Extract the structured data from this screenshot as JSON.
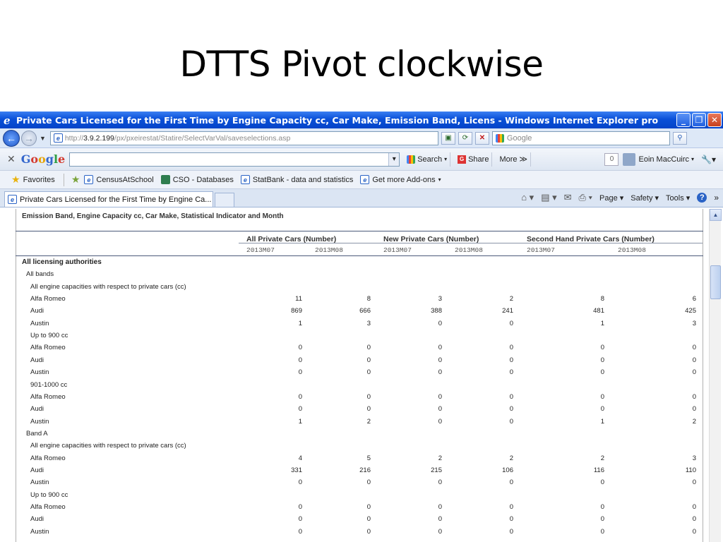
{
  "slide": {
    "title": "DTTS Pivot clockwise"
  },
  "window": {
    "title": "Private Cars Licensed for the First Time by Engine Capacity cc, Car Make, Emission Band, Licens - Windows Internet Explorer pro",
    "buttons": {
      "minimize": "_",
      "maximize": "❐",
      "close": "✕"
    }
  },
  "address_bar": {
    "url_prefix": "http://",
    "url_host": "3.9.2.199",
    "url_path": "/px/pxeirestat/Statire/SelectVarVal/saveselections.asp",
    "search_placeholder": "Google"
  },
  "google_toolbar": {
    "close": "✕",
    "logo": [
      "G",
      "o",
      "o",
      "g",
      "l",
      "e"
    ],
    "search_label": "Search",
    "share_label": "Share",
    "more_label": "More ≫",
    "count": "0",
    "user": "Eoin MacCuirc"
  },
  "favorites_bar": {
    "favorites_label": "Favorites",
    "links": [
      "CensusAtSchool",
      "CSO - Databases",
      "StatBank - data and statistics",
      "Get more Add-ons"
    ]
  },
  "tab_bar": {
    "tab_title": "Private Cars Licensed for the First Time by Engine Ca...",
    "commands": {
      "page": "Page",
      "safety": "Safety",
      "tools": "Tools",
      "help": "?"
    }
  },
  "table": {
    "header_text": "Emission Band, Engine Capacity cc, Car Make, Statistical Indicator and Month",
    "groups": [
      "All Private Cars (Number)",
      "New Private Cars (Number)",
      "Second Hand Private Cars (Number)"
    ],
    "months": [
      "2013M07",
      "2013M08",
      "2013M07",
      "2013M08",
      "2013M07",
      "2013M08"
    ],
    "rows": [
      {
        "label": "All licensing authorities",
        "level": 0,
        "bold": true,
        "values": []
      },
      {
        "label": "All bands",
        "level": 1,
        "values": []
      },
      {
        "label": "All engine capacities with respect to private cars (cc)",
        "level": 2,
        "values": []
      },
      {
        "label": "Alfa Romeo",
        "level": 2,
        "values": [
          "11",
          "8",
          "3",
          "2",
          "8",
          "6"
        ]
      },
      {
        "label": "Audi",
        "level": 2,
        "values": [
          "869",
          "666",
          "388",
          "241",
          "481",
          "425"
        ]
      },
      {
        "label": "Austin",
        "level": 2,
        "values": [
          "1",
          "3",
          "0",
          "0",
          "1",
          "3"
        ]
      },
      {
        "label": "Up to 900 cc",
        "level": 2,
        "values": []
      },
      {
        "label": "Alfa Romeo",
        "level": 2,
        "values": [
          "0",
          "0",
          "0",
          "0",
          "0",
          "0"
        ]
      },
      {
        "label": "Audi",
        "level": 2,
        "values": [
          "0",
          "0",
          "0",
          "0",
          "0",
          "0"
        ]
      },
      {
        "label": "Austin",
        "level": 2,
        "values": [
          "0",
          "0",
          "0",
          "0",
          "0",
          "0"
        ]
      },
      {
        "label": "901-1000 cc",
        "level": 2,
        "values": []
      },
      {
        "label": "Alfa Romeo",
        "level": 2,
        "values": [
          "0",
          "0",
          "0",
          "0",
          "0",
          "0"
        ]
      },
      {
        "label": "Audi",
        "level": 2,
        "values": [
          "0",
          "0",
          "0",
          "0",
          "0",
          "0"
        ]
      },
      {
        "label": "Austin",
        "level": 2,
        "values": [
          "1",
          "2",
          "0",
          "0",
          "1",
          "2"
        ]
      },
      {
        "label": "Band A",
        "level": 1,
        "values": []
      },
      {
        "label": "All engine capacities with respect to private cars (cc)",
        "level": 2,
        "values": []
      },
      {
        "label": "Alfa Romeo",
        "level": 2,
        "values": [
          "4",
          "5",
          "2",
          "2",
          "2",
          "3"
        ]
      },
      {
        "label": "Audi",
        "level": 2,
        "values": [
          "331",
          "216",
          "215",
          "106",
          "116",
          "110"
        ]
      },
      {
        "label": "Austin",
        "level": 2,
        "values": [
          "0",
          "0",
          "0",
          "0",
          "0",
          "0"
        ]
      },
      {
        "label": "Up to 900 cc",
        "level": 2,
        "values": []
      },
      {
        "label": "Alfa Romeo",
        "level": 2,
        "values": [
          "0",
          "0",
          "0",
          "0",
          "0",
          "0"
        ]
      },
      {
        "label": "Audi",
        "level": 2,
        "values": [
          "0",
          "0",
          "0",
          "0",
          "0",
          "0"
        ]
      },
      {
        "label": "Austin",
        "level": 2,
        "values": [
          "0",
          "0",
          "0",
          "0",
          "0",
          "0"
        ]
      }
    ]
  }
}
